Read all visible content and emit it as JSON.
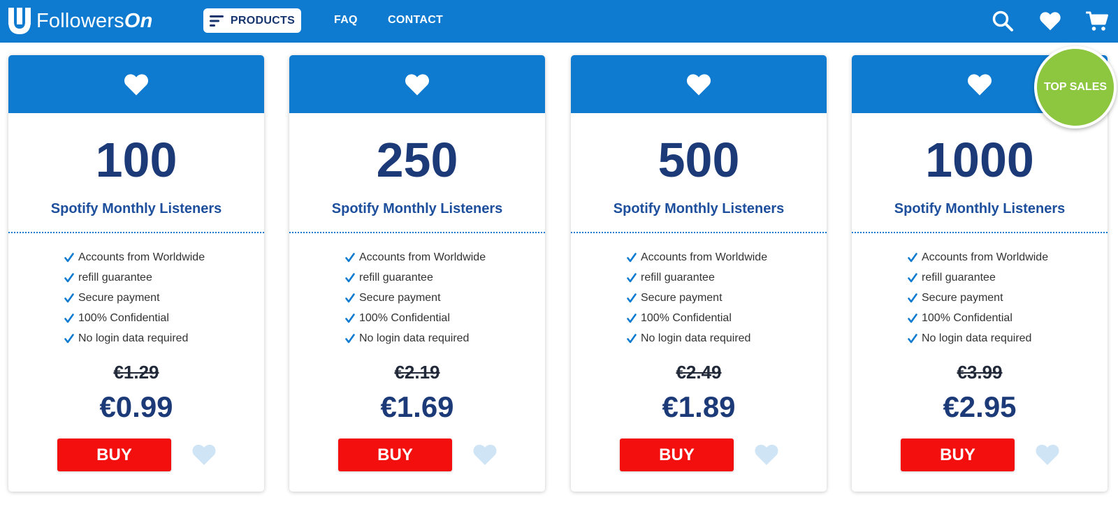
{
  "brand": {
    "name_regular": "Followers",
    "name_strong": "On",
    "logo_icon": "u-logo-icon"
  },
  "nav": {
    "products_label": "PRODUCTS",
    "faq_label": "FAQ",
    "contact_label": "CONTACT",
    "icons": [
      "search-icon",
      "heart-icon",
      "cart-icon"
    ]
  },
  "colors": {
    "primary": "#0e7bd0",
    "dark_blue": "#1b3a77",
    "buy_red": "#f40f0f",
    "badge_green": "#8dc63f",
    "wish_light": "#cfe4f5"
  },
  "badge": {
    "label": "TOP SALES"
  },
  "cards": [
    {
      "quantity": "100",
      "service": "Spotify Monthly Listeners",
      "features": [
        "Accounts from Worldwide",
        "refill guarantee",
        "Secure payment",
        "100% Confidential",
        "No login data required"
      ],
      "old_price": "€1.29",
      "price": "€0.99",
      "buy_label": "BUY"
    },
    {
      "quantity": "250",
      "service": "Spotify Monthly Listeners",
      "features": [
        "Accounts from Worldwide",
        "refill guarantee",
        "Secure payment",
        "100% Confidential",
        "No login data required"
      ],
      "old_price": "€2.19",
      "price": "€1.69",
      "buy_label": "BUY"
    },
    {
      "quantity": "500",
      "service": "Spotify Monthly Listeners",
      "features": [
        "Accounts from Worldwide",
        "refill guarantee",
        "Secure payment",
        "100% Confidential",
        "No login data required"
      ],
      "old_price": "€2.49",
      "price": "€1.89",
      "buy_label": "BUY"
    },
    {
      "quantity": "1000",
      "service": "Spotify Monthly Listeners",
      "features": [
        "Accounts from Worldwide",
        "refill guarantee",
        "Secure payment",
        "100% Confidential",
        "No login data required"
      ],
      "old_price": "€3.99",
      "price": "€2.95",
      "buy_label": "BUY"
    }
  ]
}
